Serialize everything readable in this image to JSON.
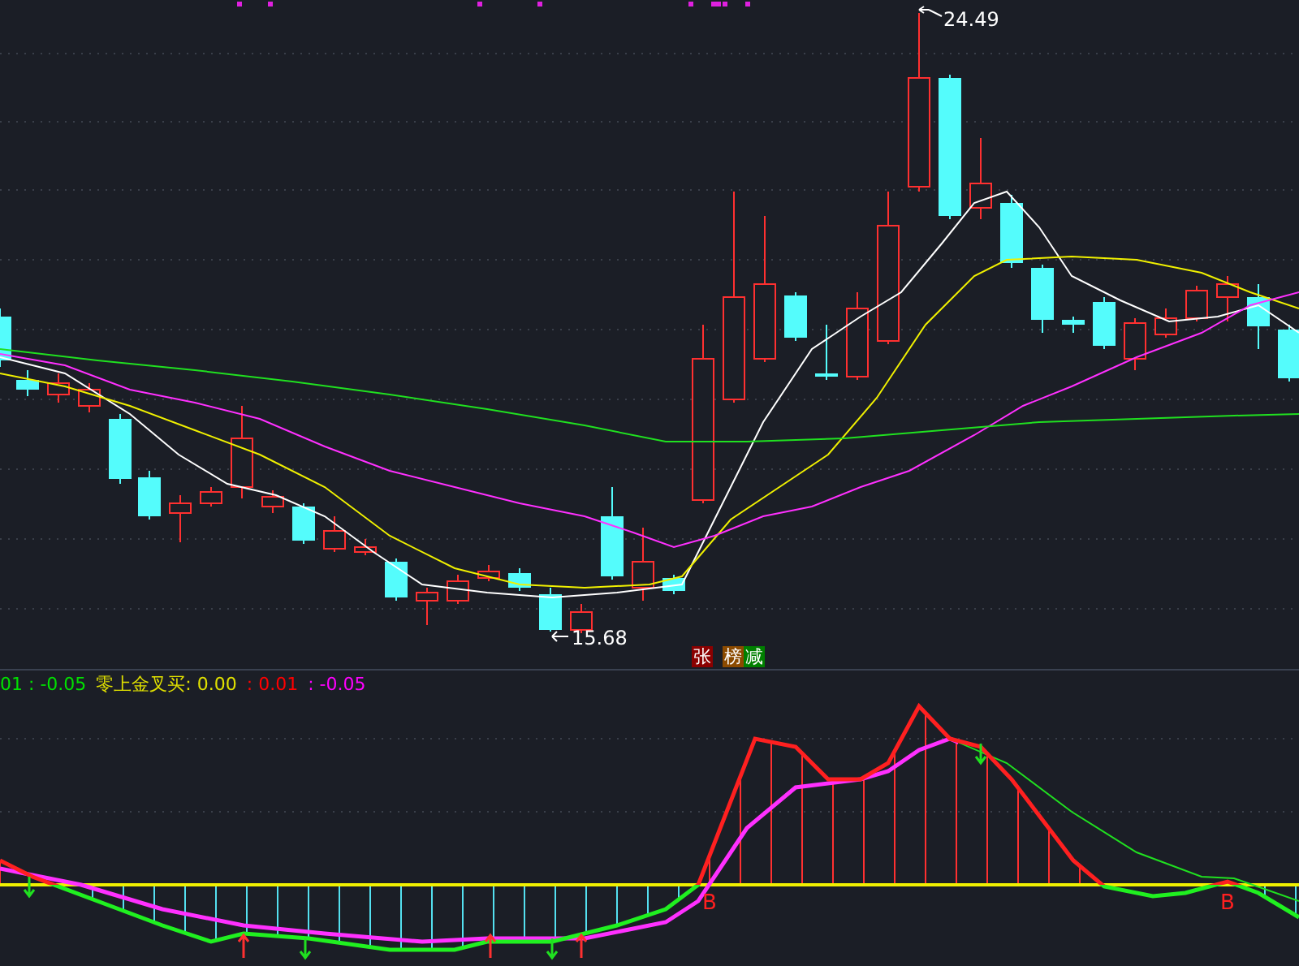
{
  "price_chart": {
    "high_label": "24.49",
    "low_label": "15.68",
    "badges": [
      {
        "text": "张",
        "color": "#8b0000"
      },
      {
        "text": "榜",
        "color": "#8b4a00"
      },
      {
        "text": "减",
        "color": "#008000"
      }
    ]
  },
  "indicator": {
    "legend": [
      {
        "text": "01 : -0.05",
        "color": "#00e000"
      },
      {
        "text": "零上金叉买: 0.00",
        "color": "#e0e000"
      },
      {
        "text": ": 0.01",
        "color": "#ff0000"
      },
      {
        "text": ": -0.05",
        "color": "#ff00ff"
      }
    ],
    "signals": [
      {
        "text": "B"
      },
      {
        "text": "B"
      }
    ]
  }
}
